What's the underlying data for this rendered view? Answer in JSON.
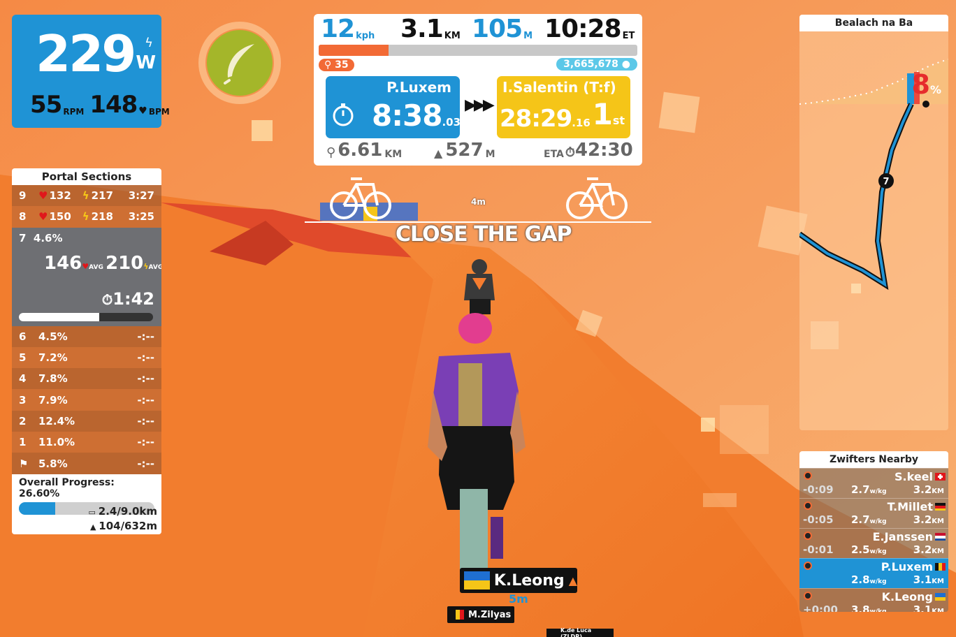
{
  "power": {
    "value": "229",
    "unit": "W",
    "cadence": "55",
    "cadence_unit": "RPM",
    "heart_rate": "148",
    "hr_unit": "BPM"
  },
  "powerup": {
    "icon": "feather-icon"
  },
  "top": {
    "speed": "12",
    "speed_unit": "kph",
    "distance": "3.1",
    "distance_unit": "KM",
    "elevation": "105",
    "elevation_unit": "M",
    "time": "10:28",
    "time_unit": "ET",
    "progress_fraction": 0.22,
    "riders": "35",
    "xp": "3,665,678",
    "you": {
      "name": "P.Luxem",
      "time": "8:38",
      "ms": ".03"
    },
    "leader": {
      "name": "I.Salentin (T:f)",
      "time": "28:29",
      "ms": ".16",
      "rank": "1",
      "rank_suffix": "st"
    },
    "remaining_distance": "6.61",
    "remaining_distance_unit": "KM",
    "remaining_elev": "527",
    "remaining_elev_unit": "M",
    "eta_label": "ETA",
    "eta": "42:30"
  },
  "portal": {
    "title": "Portal Sections",
    "done": [
      {
        "n": "9",
        "hr": "132",
        "w": "217",
        "t": "3:27"
      },
      {
        "n": "8",
        "hr": "150",
        "w": "218",
        "t": "3:25"
      }
    ],
    "active": {
      "n": "7",
      "grade": "4.6%",
      "avg_hr": "146",
      "avg_w": "210",
      "avg_label": "AVG",
      "time": "1:42",
      "fraction": 0.6
    },
    "upcoming": [
      {
        "n": "6",
        "g": "4.5%",
        "t": "-:--"
      },
      {
        "n": "5",
        "g": "7.2%",
        "t": "-:--"
      },
      {
        "n": "4",
        "g": "7.8%",
        "t": "-:--"
      },
      {
        "n": "3",
        "g": "7.9%",
        "t": "-:--"
      },
      {
        "n": "2",
        "g": "12.4%",
        "t": "-:--"
      },
      {
        "n": "1",
        "g": "11.0%",
        "t": "-:--"
      },
      {
        "n": "",
        "g": "5.8%",
        "t": "-:--"
      }
    ],
    "overall_label": "Overall Progress: 26.60%",
    "overall_fraction": 0.266,
    "dist": "2.4/9.0km",
    "elev": "104/632m"
  },
  "route": {
    "title": "Bealach na Ba",
    "grade": "8",
    "grade_unit": "%",
    "marker": "7"
  },
  "nearby": {
    "title": "Zwifters Nearby",
    "rows": [
      {
        "gap": "-0:09",
        "name": "S.keel",
        "wkg": "2.7",
        "km": "3.2",
        "flag": "ch",
        "me": false
      },
      {
        "gap": "-0:05",
        "name": "T.Millet",
        "wkg": "2.7",
        "km": "3.2",
        "flag": "de",
        "me": false
      },
      {
        "gap": "-0:01",
        "name": "E.Janssen",
        "wkg": "2.5",
        "km": "3.2",
        "flag": "nl",
        "me": false
      },
      {
        "gap": "",
        "name": "P.Luxem",
        "wkg": "2.8",
        "km": "3.1",
        "flag": "be",
        "me": true
      },
      {
        "gap": "+0:00",
        "name": "K.Leong",
        "wkg": "3.8",
        "km": "3.1",
        "flag": "ua",
        "me": false
      }
    ],
    "wkg_unit": "w/kg",
    "km_unit": "KM"
  },
  "gap": {
    "title": "CLOSE THE GAP",
    "distance": "4m"
  },
  "tags": {
    "k_leong": {
      "name": "K.Leong",
      "dist": "5m"
    },
    "m_zilyas": {
      "name": "M.Zilyas"
    },
    "k_de_luca": {
      "name": "K.de Luca (ZLDR)"
    }
  }
}
